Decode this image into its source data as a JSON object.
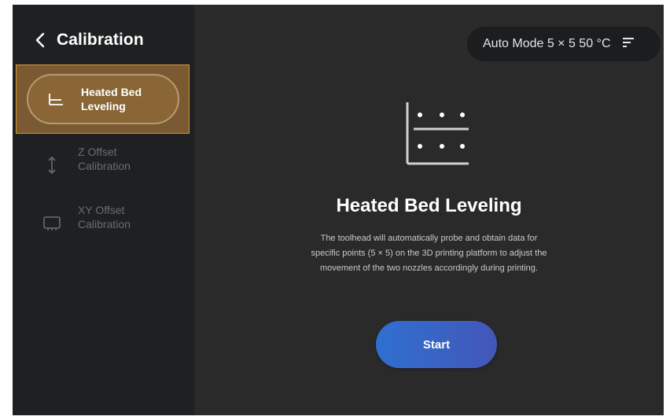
{
  "header": {
    "title": "Calibration"
  },
  "sidebar": {
    "items": [
      {
        "label_line1": "Heated Bed",
        "label_line2": "Leveling",
        "icon": "bed-leveling-icon",
        "active": true
      },
      {
        "label_line1": "Z Offset",
        "label_line2": "Calibration",
        "icon": "vertical-arrows-icon",
        "active": false
      },
      {
        "label_line1": "XY Offset",
        "label_line2": "Calibration",
        "icon": "monitor-icon",
        "active": false
      }
    ]
  },
  "mode": {
    "text": "Auto Mode 5 × 5 50 °C",
    "icon": "filter-icon"
  },
  "main": {
    "icon": "bed-grid-icon",
    "title": "Heated Bed Leveling",
    "description_line1": "The toolhead will automatically probe and obtain data for",
    "description_line2": "specific points (5 × 5) on the 3D printing platform to adjust the",
    "description_line3": "movement of the two nozzles accordingly during printing.",
    "start_label": "Start"
  },
  "colors": {
    "accent_orange": "#d8972e",
    "button_blue": "#3a62c4",
    "panel_bg": "#2a2a2b",
    "sidebar_bg": "#1e2022"
  }
}
